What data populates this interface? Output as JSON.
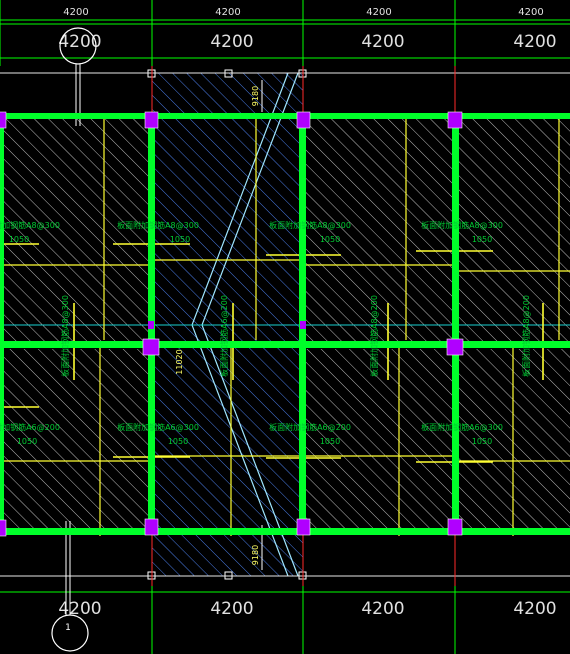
{
  "colors": {
    "background": "#000000",
    "beam": "#00ff2a",
    "axis": "#ff2a2a",
    "bay_line": "#ffff33",
    "dim_line": "#00ff00",
    "dim_text": "#e0e0e0",
    "column": "#b000ff",
    "rebar_text": "#00cc33",
    "stair_hatch": "#3a6bd8",
    "stair_edge": "#9fe6ff",
    "hatch": "#c8c8c8",
    "bubble": "#ffffff"
  },
  "dimensions": {
    "top_small": [
      "4200",
      "4200",
      "4200",
      "4200"
    ],
    "top_large": [
      "4200",
      "4200",
      "4200",
      "4200"
    ],
    "bottom_large": [
      "4200",
      "4200",
      "4200",
      "4200"
    ]
  },
  "axis_bubbles": {
    "bottom_left": "1"
  },
  "stair": {
    "flight_top": "9180",
    "flight_bottom": "9180",
    "landing": "11020"
  },
  "slabs": {
    "upper_rows": [
      {
        "label": "板面附加钢筋A8@300",
        "length": "1050"
      },
      {
        "label": "板面附加钢筋A8@300",
        "length": "1050"
      },
      {
        "label": "板面附加钢筋A8@300",
        "length": "1050"
      },
      {
        "label": "板面附加钢筋A8@300",
        "length": "1050"
      }
    ],
    "lower_rows": [
      {
        "label": "板面附加钢筋A6@200",
        "length": "1050"
      },
      {
        "label": "板面附加钢筋A6@300",
        "length": "1050"
      },
      {
        "label": "板面附加钢筋A6@200",
        "length": "1050"
      },
      {
        "label": "板面附加钢筋A6@300",
        "length": "1050"
      }
    ],
    "vertical_labels": [
      "板面附加钢筋A8@300",
      "板面附加钢筋A6@200",
      "板面附加钢筋A8@200",
      "板面附加钢筋A8@200"
    ]
  }
}
